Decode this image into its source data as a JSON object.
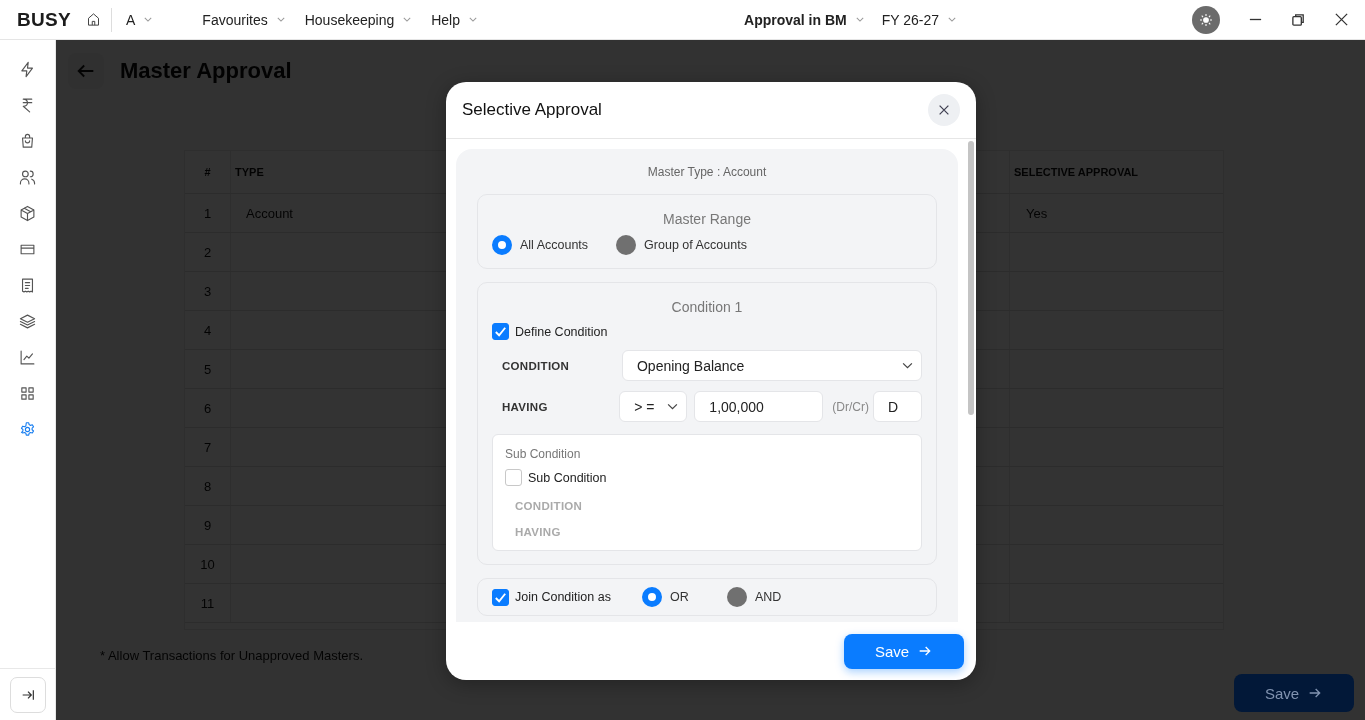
{
  "topbar": {
    "logo": "BUSY",
    "company": "A",
    "menus": [
      "Favourites",
      "Housekeeping",
      "Help"
    ],
    "context": "Approval in BM",
    "year": "FY 26-27"
  },
  "sidebar": {
    "items": [
      {
        "selected": false
      },
      {
        "selected": false
      },
      {
        "selected": false
      },
      {
        "selected": false
      },
      {
        "selected": false
      },
      {
        "selected": false
      },
      {
        "selected": false
      },
      {
        "selected": false
      },
      {
        "selected": false
      },
      {
        "selected": false
      },
      {
        "selected": true
      }
    ]
  },
  "page": {
    "title": "Master Approval",
    "table": {
      "columns": [
        "#",
        "TYPE",
        "SELECTIVE APPROVAL"
      ],
      "rows": [
        {
          "number": "1",
          "type": "Account",
          "selective_approval": "Yes"
        },
        {
          "number": "2"
        },
        {
          "number": "3"
        },
        {
          "number": "4"
        },
        {
          "number": "5"
        },
        {
          "number": "6"
        },
        {
          "number": "7"
        },
        {
          "number": "8"
        },
        {
          "number": "9"
        },
        {
          "number": "10"
        },
        {
          "number": "11"
        }
      ]
    },
    "footnote": "* Allow Transactions for Unapproved Masters.",
    "save": "Save"
  },
  "dialog": {
    "title": "Selective Approval",
    "master_type": "Master Type : Account",
    "master_range": {
      "title": "Master Range",
      "options": [
        {
          "label": "All Accounts",
          "selected": true
        },
        {
          "label": "Group of Accounts",
          "selected": false
        }
      ]
    },
    "condition": {
      "title": "Condition 1",
      "define": {
        "label": "Define Condition",
        "checked": true
      },
      "condition_label": "CONDITION",
      "condition_value": "Opening Balance",
      "having_label": "HAVING",
      "operator": "> =",
      "amount": "1,00,000",
      "drcr_label": "(Dr/Cr)",
      "drcr": "D",
      "sub": {
        "title": "Sub Condition",
        "checkbox": {
          "label": "Sub Condition",
          "checked": false
        },
        "disabled": true,
        "condition_label": "CONDITION",
        "having_label": "HAVING"
      }
    },
    "join": {
      "checkbox": {
        "label": "Join Condition as",
        "checked": true
      },
      "options": [
        {
          "label": "OR",
          "selected": true
        },
        {
          "label": "AND",
          "selected": false
        }
      ]
    },
    "save": "Save"
  }
}
